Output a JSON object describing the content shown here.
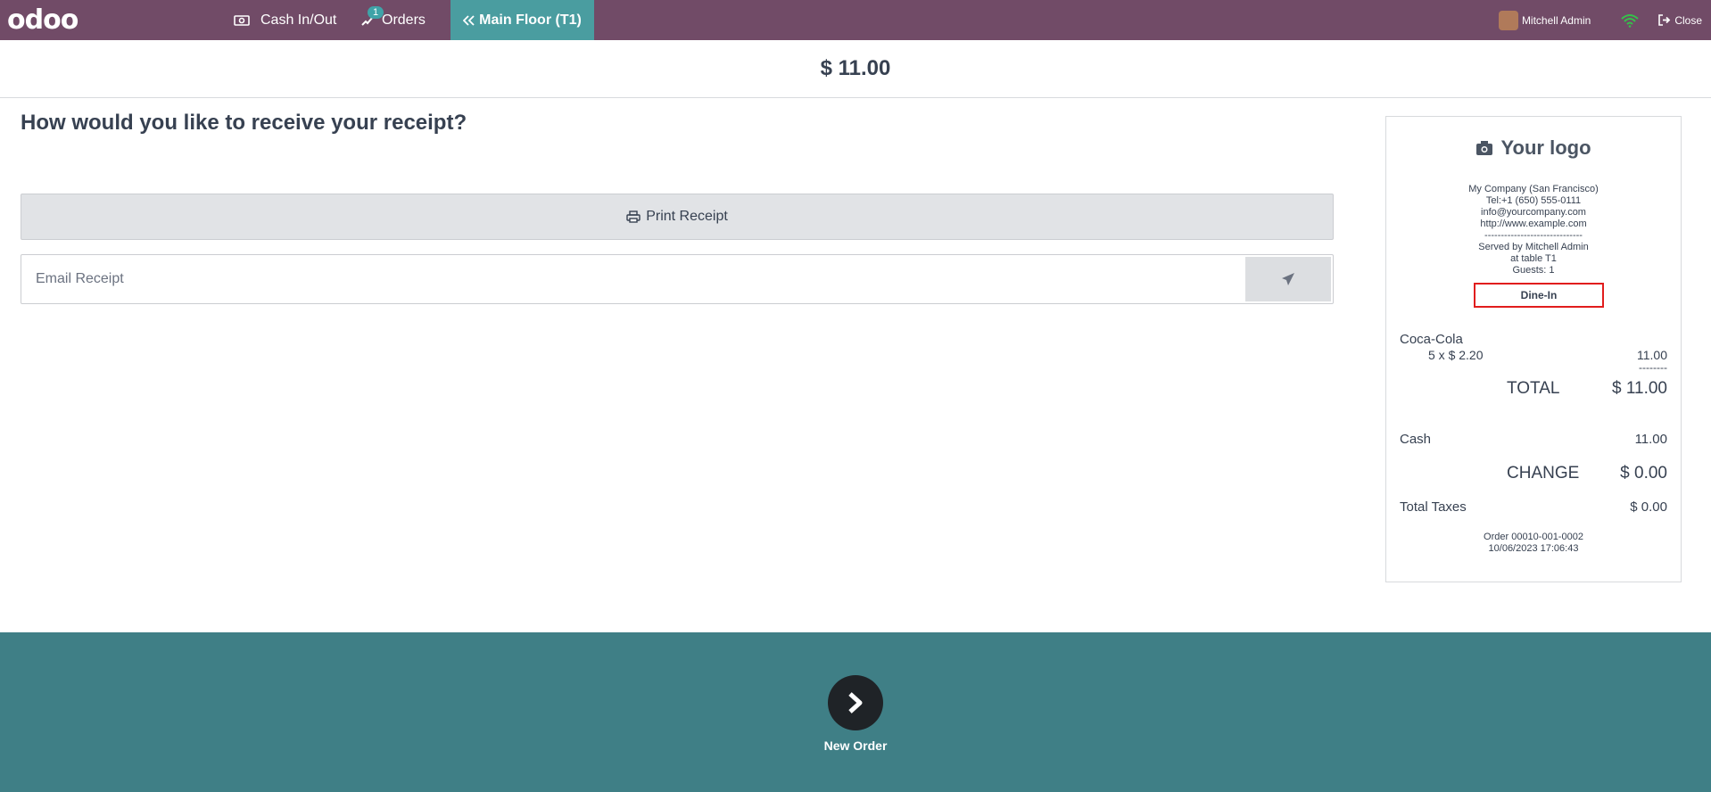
{
  "navbar": {
    "logo": "odoo",
    "cash_label": "Cash In/Out",
    "orders_label": "Orders",
    "orders_badge": "1",
    "floor_label": "Main Floor (T1)",
    "user_name": "Mitchell Admin",
    "close_label": "Close",
    "bg_color": "#714B67"
  },
  "payment": {
    "amount": "$ 11.00",
    "question": "How would you like to receive your receipt?",
    "print_label": "Print Receipt",
    "email_placeholder": "Email Receipt"
  },
  "receipt": {
    "logo_text": "Your logo",
    "company_lines": [
      "My Company (San Francisco)",
      "Tel:+1 (650) 555-0111",
      "info@yourcompany.com",
      "http://www.example.com",
      "------------------------------",
      "Served by Mitchell Admin",
      "at table T1",
      "Guests: 1"
    ],
    "dine_in": "Dine-In",
    "item_name": "Coca-Cola",
    "item_qty": "5 x $ 2.20",
    "item_total": "11.00",
    "separator": "--------",
    "total_label": "TOTAL",
    "total_value": "$ 11.00",
    "cash_label": "Cash",
    "cash_value": "11.00",
    "change_label": "CHANGE",
    "change_value": "$ 0.00",
    "taxes_label": "Total Taxes",
    "taxes_value": "$ 0.00",
    "order_ref": "Order 00010-001-0002",
    "order_date": "10/06/2023 17:06:43"
  },
  "footer": {
    "next_label": "New Order",
    "bg_color": "#3f7f86"
  }
}
